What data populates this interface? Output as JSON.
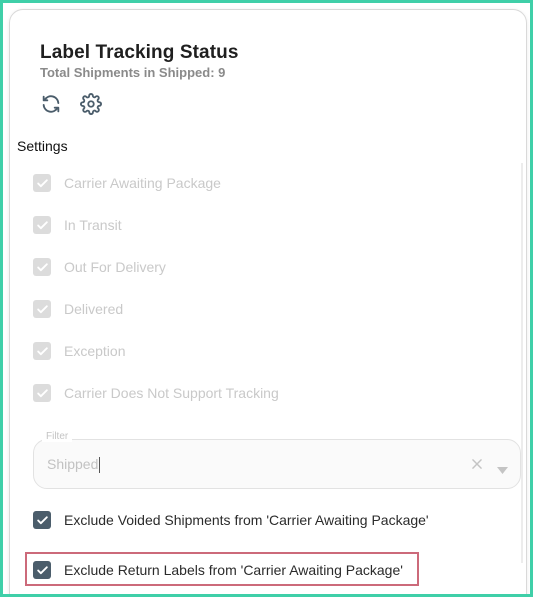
{
  "header": {
    "title": "Label Tracking Status",
    "subtitle": "Total Shipments in Shipped: 9"
  },
  "toolbar": {
    "refresh_icon": "refresh-icon",
    "settings_icon": "gear-icon"
  },
  "settings": {
    "label": "Settings",
    "status_options": [
      {
        "label": "Carrier Awaiting Package",
        "checked": true,
        "disabled": true
      },
      {
        "label": "In Transit",
        "checked": true,
        "disabled": true
      },
      {
        "label": "Out For Delivery",
        "checked": true,
        "disabled": true
      },
      {
        "label": "Delivered",
        "checked": true,
        "disabled": true
      },
      {
        "label": "Exception",
        "checked": true,
        "disabled": true
      },
      {
        "label": "Carrier Does Not Support Tracking",
        "checked": true,
        "disabled": true
      }
    ],
    "filter": {
      "legend": "Filter",
      "value": "Shipped"
    },
    "exclude_voided": {
      "label": "Exclude Voided Shipments from 'Carrier Awaiting Package'",
      "checked": true
    },
    "exclude_returns": {
      "label": "Exclude Return Labels from 'Carrier Awaiting Package'",
      "checked": true
    }
  },
  "colors": {
    "checkbox_checked": "#4b5d6b",
    "checkbox_disabled": "#dcdcdc",
    "highlight_border": "#cc6a7a",
    "outer_frame": "#3fcfa8"
  }
}
